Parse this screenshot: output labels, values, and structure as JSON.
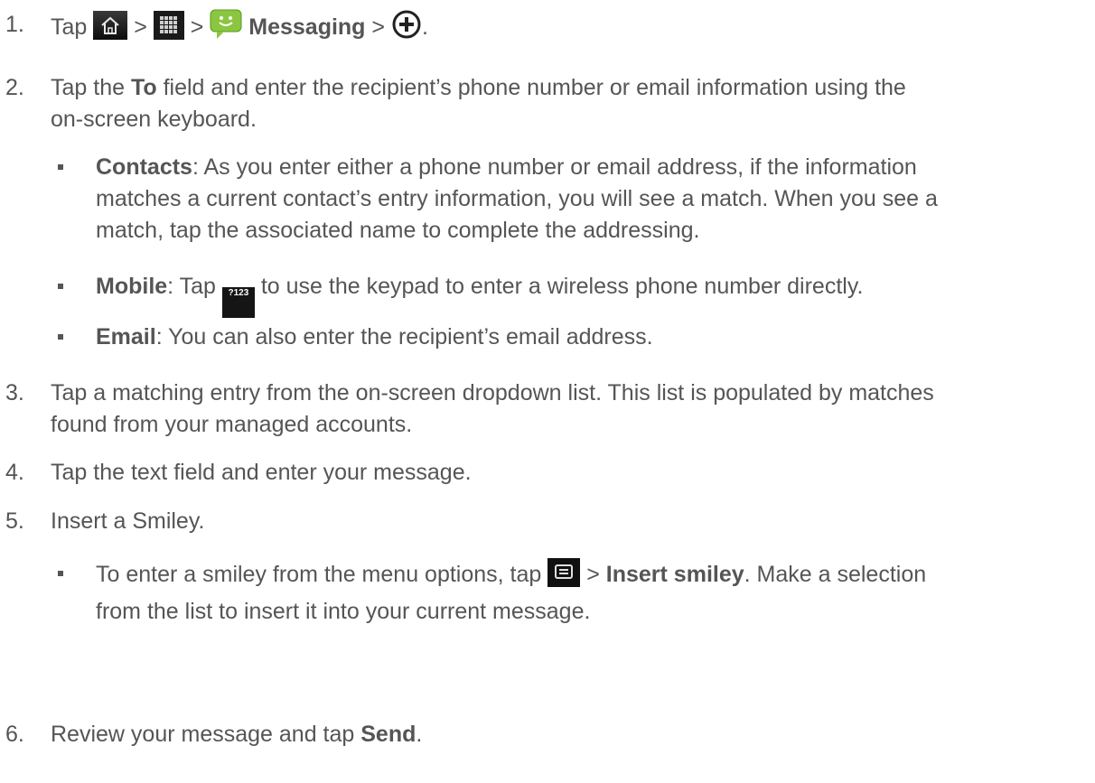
{
  "steps": [
    {
      "number": "1.",
      "parts": [
        "Tap",
        ">",
        ">",
        "Messaging",
        ">",
        "."
      ],
      "icons": [
        "home-icon",
        "apps-grid-icon",
        "messaging-app-icon",
        "plus-circle-icon"
      ]
    },
    {
      "number": "2.",
      "pre": "Tap the ",
      "bold": "To",
      "post": " field and enter the recipient’s phone number or email information using the",
      "line2": "on-screen keyboard.",
      "bullets": [
        {
          "bold": "Contacts",
          "text": ": As you enter either a phone number or email address, if the information",
          "line2": "matches a current contact’s entry information, you will see a match. When you see a",
          "line3": "match, tap the associated name to complete the addressing."
        },
        {
          "bold": "Mobile",
          "text_pre": ": Tap",
          "icon_label": "?123",
          "icon": "numeric-keypad-key-icon",
          "text": "to use the keypad to enter a wireless phone number directly."
        },
        {
          "bold": "Email",
          "text": ": You can also enter the recipient’s email address."
        }
      ]
    },
    {
      "number": "3.",
      "text": "Tap a matching entry from the on-screen dropdown list. This list is populated by matches",
      "line2": "found from your managed accounts."
    },
    {
      "number": "4.",
      "text": "Tap the text field and enter your message."
    },
    {
      "number": "5.",
      "text": "Insert a Smiley.",
      "bullets": [
        {
          "text_pre": "To enter a smiley from the menu options, tap",
          "icon": "menu-key-icon",
          "sep": ">",
          "bold": "Insert smiley",
          "text": ". Make a selection",
          "line2": "from the list to insert it into your current message."
        }
      ]
    },
    {
      "number": "6.",
      "pre": "Review your message and tap ",
      "bold": "Send",
      "post": "."
    }
  ]
}
